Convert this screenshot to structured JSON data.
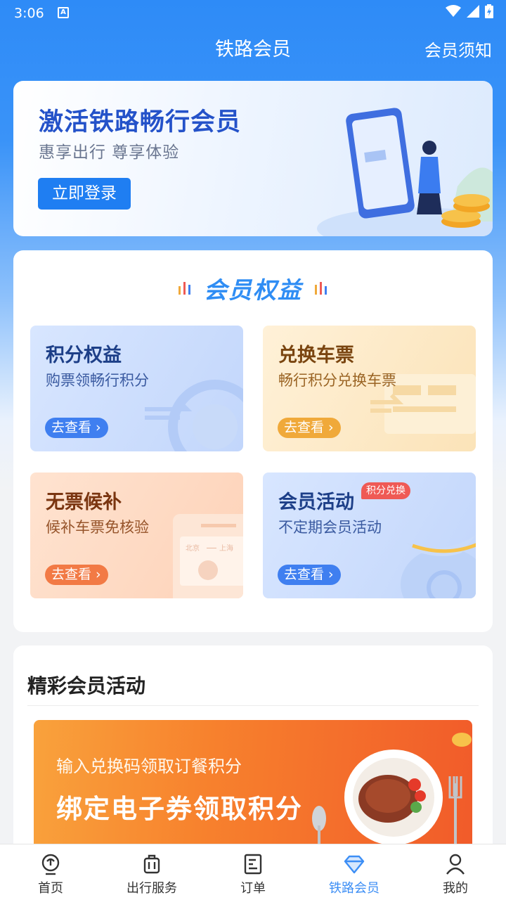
{
  "status_bar": {
    "time": "3:06",
    "notification_icon": "A"
  },
  "nav": {
    "title": "铁路会员",
    "right_link": "会员须知"
  },
  "hero": {
    "title": "激活铁路畅行会员",
    "subtitle": "惠享出行 尊享体验",
    "button": "立即登录"
  },
  "benefits": {
    "title": "会员权益",
    "cards": [
      {
        "title": "积分权益",
        "subtitle": "购票领畅行积分",
        "button": "去查看"
      },
      {
        "title": "兑换车票",
        "subtitle": "畅行积分兑换车票",
        "button": "去查看"
      },
      {
        "title": "无票候补",
        "subtitle": "候补车票免核验",
        "button": "去查看",
        "ticket_from": "北京",
        "ticket_to": "上海"
      },
      {
        "title": "会员活动",
        "subtitle": "不定期会员活动",
        "button": "去查看",
        "tag": "积分兑换"
      }
    ]
  },
  "activities": {
    "title": "精彩会员活动",
    "banner": {
      "subtitle": "输入兑换码领取订餐积分",
      "title": "绑定电子券领取积分"
    }
  },
  "tabbar": {
    "items": [
      {
        "label": "首页",
        "icon": "railway-home-icon"
      },
      {
        "label": "出行服务",
        "icon": "luggage-icon"
      },
      {
        "label": "订单",
        "icon": "order-list-icon"
      },
      {
        "label": "铁路会员",
        "icon": "diamond-icon",
        "active": true
      },
      {
        "label": "我的",
        "icon": "user-icon"
      }
    ]
  },
  "colors": {
    "primary": "#1f7ef2",
    "header_blue": "#2e8bf7",
    "active_tab": "#3c8ef5",
    "tag_red": "#ef5a55"
  }
}
